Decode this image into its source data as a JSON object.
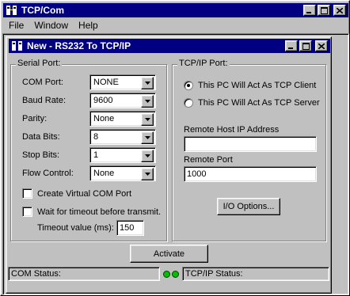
{
  "app": {
    "title": "TCP/Com",
    "menu": [
      "File",
      "Window",
      "Help"
    ]
  },
  "child": {
    "title": "New - RS232 To TCP/IP"
  },
  "serial": {
    "group_label": "Serial Port:",
    "com_port_label": "COM Port:",
    "com_port_value": "NONE",
    "baud_label": "Baud Rate:",
    "baud_value": "9600",
    "parity_label": "Parity:",
    "parity_value": "None",
    "data_bits_label": "Data Bits:",
    "data_bits_value": "8",
    "stop_bits_label": "Stop Bits:",
    "stop_bits_value": "1",
    "flow_label": "Flow Control:",
    "flow_value": "None",
    "virtual_com_label": "Create Virtual COM Port",
    "wait_label": "Wait for timeout before transmit.",
    "timeout_label": "Timeout value (ms):",
    "timeout_value": "150"
  },
  "tcp": {
    "group_label": "TCP/IP Port:",
    "client_label": "This PC Will Act As TCP Client",
    "server_label": "This PC Will Act As TCP Server",
    "remote_ip_label": "Remote Host IP Address",
    "remote_ip_value": "",
    "remote_port_label": "Remote Port",
    "remote_port_value": "1000",
    "io_options_label": "I/O Options..."
  },
  "activate_label": "Activate",
  "status": {
    "com": "COM Status:",
    "tcp": "TCP/IP Status:"
  },
  "colors": {
    "title_bar": "#000080",
    "face": "#c0c0c0",
    "led": "#00c000"
  }
}
